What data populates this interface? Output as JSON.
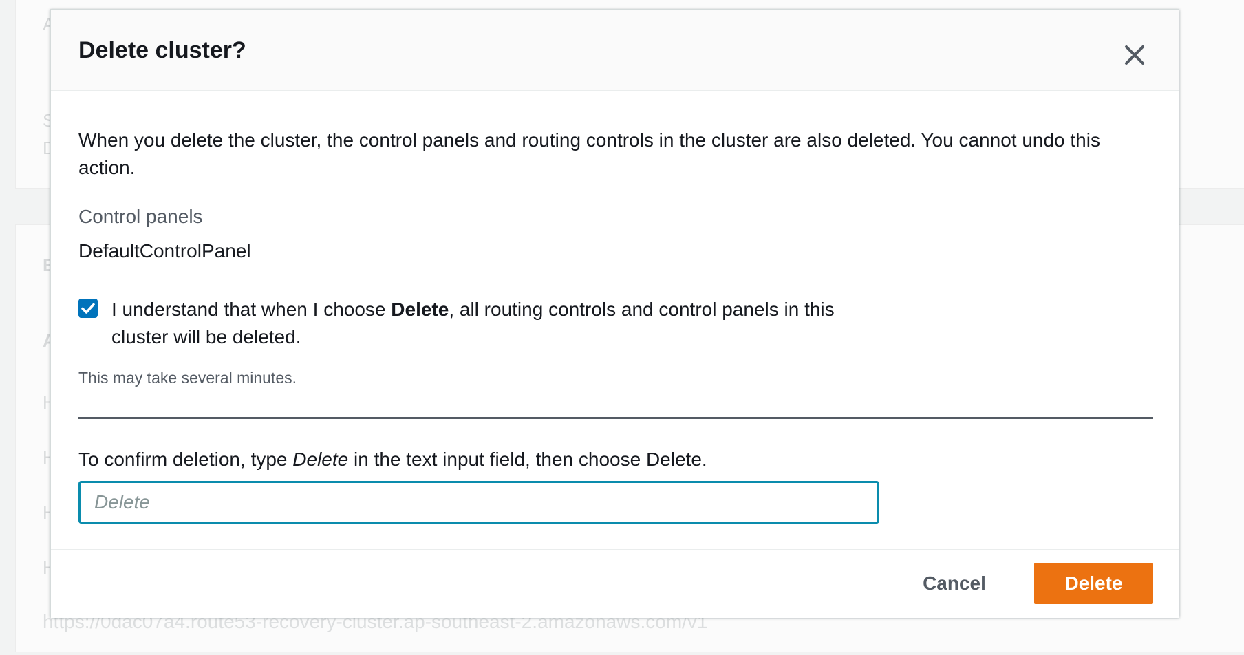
{
  "background": {
    "letters": [
      "A",
      "S",
      "D",
      "E",
      "A",
      "H",
      "H",
      "H",
      "H"
    ],
    "endpoint_url": "https://0dac07a4.route53-recovery-cluster.ap-southeast-2.amazonaws.com/v1"
  },
  "modal": {
    "title": "Delete cluster?",
    "description": "When you delete the cluster, the control panels and routing controls in the cluster are also deleted. You cannot undo this action.",
    "control_panels_label": "Control panels",
    "control_panels_value": "DefaultControlPanel",
    "acknowledge": {
      "checked": true,
      "text_before": "I understand that when I choose ",
      "text_bold": "Delete",
      "text_after": ", all routing controls and control panels in this cluster will be deleted."
    },
    "hint": "This may take several minutes.",
    "confirm": {
      "label_before": "To confirm deletion, type ",
      "label_italic": "Delete",
      "label_after": " in the text input field, then choose Delete.",
      "placeholder": "Delete",
      "value": ""
    },
    "footer": {
      "cancel_label": "Cancel",
      "delete_label": "Delete"
    }
  },
  "colors": {
    "primary_button": "#ec7211",
    "checkbox": "#0073bb",
    "input_focus_border": "#0a8cad"
  }
}
